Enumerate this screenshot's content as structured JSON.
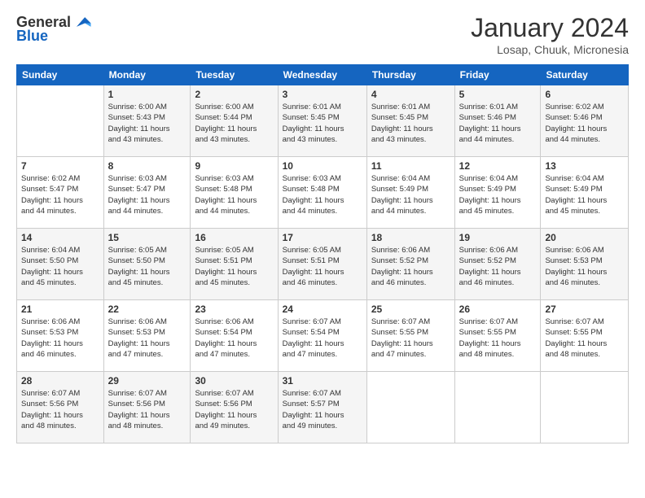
{
  "header": {
    "logo_general": "General",
    "logo_blue": "Blue",
    "month_title": "January 2024",
    "location": "Losap, Chuuk, Micronesia"
  },
  "days_of_week": [
    "Sunday",
    "Monday",
    "Tuesday",
    "Wednesday",
    "Thursday",
    "Friday",
    "Saturday"
  ],
  "weeks": [
    [
      {
        "day": "",
        "info": ""
      },
      {
        "day": "1",
        "info": "Sunrise: 6:00 AM\nSunset: 5:43 PM\nDaylight: 11 hours\nand 43 minutes."
      },
      {
        "day": "2",
        "info": "Sunrise: 6:00 AM\nSunset: 5:44 PM\nDaylight: 11 hours\nand 43 minutes."
      },
      {
        "day": "3",
        "info": "Sunrise: 6:01 AM\nSunset: 5:45 PM\nDaylight: 11 hours\nand 43 minutes."
      },
      {
        "day": "4",
        "info": "Sunrise: 6:01 AM\nSunset: 5:45 PM\nDaylight: 11 hours\nand 43 minutes."
      },
      {
        "day": "5",
        "info": "Sunrise: 6:01 AM\nSunset: 5:46 PM\nDaylight: 11 hours\nand 44 minutes."
      },
      {
        "day": "6",
        "info": "Sunrise: 6:02 AM\nSunset: 5:46 PM\nDaylight: 11 hours\nand 44 minutes."
      }
    ],
    [
      {
        "day": "7",
        "info": "Sunrise: 6:02 AM\nSunset: 5:47 PM\nDaylight: 11 hours\nand 44 minutes."
      },
      {
        "day": "8",
        "info": "Sunrise: 6:03 AM\nSunset: 5:47 PM\nDaylight: 11 hours\nand 44 minutes."
      },
      {
        "day": "9",
        "info": "Sunrise: 6:03 AM\nSunset: 5:48 PM\nDaylight: 11 hours\nand 44 minutes."
      },
      {
        "day": "10",
        "info": "Sunrise: 6:03 AM\nSunset: 5:48 PM\nDaylight: 11 hours\nand 44 minutes."
      },
      {
        "day": "11",
        "info": "Sunrise: 6:04 AM\nSunset: 5:49 PM\nDaylight: 11 hours\nand 44 minutes."
      },
      {
        "day": "12",
        "info": "Sunrise: 6:04 AM\nSunset: 5:49 PM\nDaylight: 11 hours\nand 45 minutes."
      },
      {
        "day": "13",
        "info": "Sunrise: 6:04 AM\nSunset: 5:49 PM\nDaylight: 11 hours\nand 45 minutes."
      }
    ],
    [
      {
        "day": "14",
        "info": "Sunrise: 6:04 AM\nSunset: 5:50 PM\nDaylight: 11 hours\nand 45 minutes."
      },
      {
        "day": "15",
        "info": "Sunrise: 6:05 AM\nSunset: 5:50 PM\nDaylight: 11 hours\nand 45 minutes."
      },
      {
        "day": "16",
        "info": "Sunrise: 6:05 AM\nSunset: 5:51 PM\nDaylight: 11 hours\nand 45 minutes."
      },
      {
        "day": "17",
        "info": "Sunrise: 6:05 AM\nSunset: 5:51 PM\nDaylight: 11 hours\nand 46 minutes."
      },
      {
        "day": "18",
        "info": "Sunrise: 6:06 AM\nSunset: 5:52 PM\nDaylight: 11 hours\nand 46 minutes."
      },
      {
        "day": "19",
        "info": "Sunrise: 6:06 AM\nSunset: 5:52 PM\nDaylight: 11 hours\nand 46 minutes."
      },
      {
        "day": "20",
        "info": "Sunrise: 6:06 AM\nSunset: 5:53 PM\nDaylight: 11 hours\nand 46 minutes."
      }
    ],
    [
      {
        "day": "21",
        "info": "Sunrise: 6:06 AM\nSunset: 5:53 PM\nDaylight: 11 hours\nand 46 minutes."
      },
      {
        "day": "22",
        "info": "Sunrise: 6:06 AM\nSunset: 5:53 PM\nDaylight: 11 hours\nand 47 minutes."
      },
      {
        "day": "23",
        "info": "Sunrise: 6:06 AM\nSunset: 5:54 PM\nDaylight: 11 hours\nand 47 minutes."
      },
      {
        "day": "24",
        "info": "Sunrise: 6:07 AM\nSunset: 5:54 PM\nDaylight: 11 hours\nand 47 minutes."
      },
      {
        "day": "25",
        "info": "Sunrise: 6:07 AM\nSunset: 5:55 PM\nDaylight: 11 hours\nand 47 minutes."
      },
      {
        "day": "26",
        "info": "Sunrise: 6:07 AM\nSunset: 5:55 PM\nDaylight: 11 hours\nand 48 minutes."
      },
      {
        "day": "27",
        "info": "Sunrise: 6:07 AM\nSunset: 5:55 PM\nDaylight: 11 hours\nand 48 minutes."
      }
    ],
    [
      {
        "day": "28",
        "info": "Sunrise: 6:07 AM\nSunset: 5:56 PM\nDaylight: 11 hours\nand 48 minutes."
      },
      {
        "day": "29",
        "info": "Sunrise: 6:07 AM\nSunset: 5:56 PM\nDaylight: 11 hours\nand 48 minutes."
      },
      {
        "day": "30",
        "info": "Sunrise: 6:07 AM\nSunset: 5:56 PM\nDaylight: 11 hours\nand 49 minutes."
      },
      {
        "day": "31",
        "info": "Sunrise: 6:07 AM\nSunset: 5:57 PM\nDaylight: 11 hours\nand 49 minutes."
      },
      {
        "day": "",
        "info": ""
      },
      {
        "day": "",
        "info": ""
      },
      {
        "day": "",
        "info": ""
      }
    ]
  ]
}
